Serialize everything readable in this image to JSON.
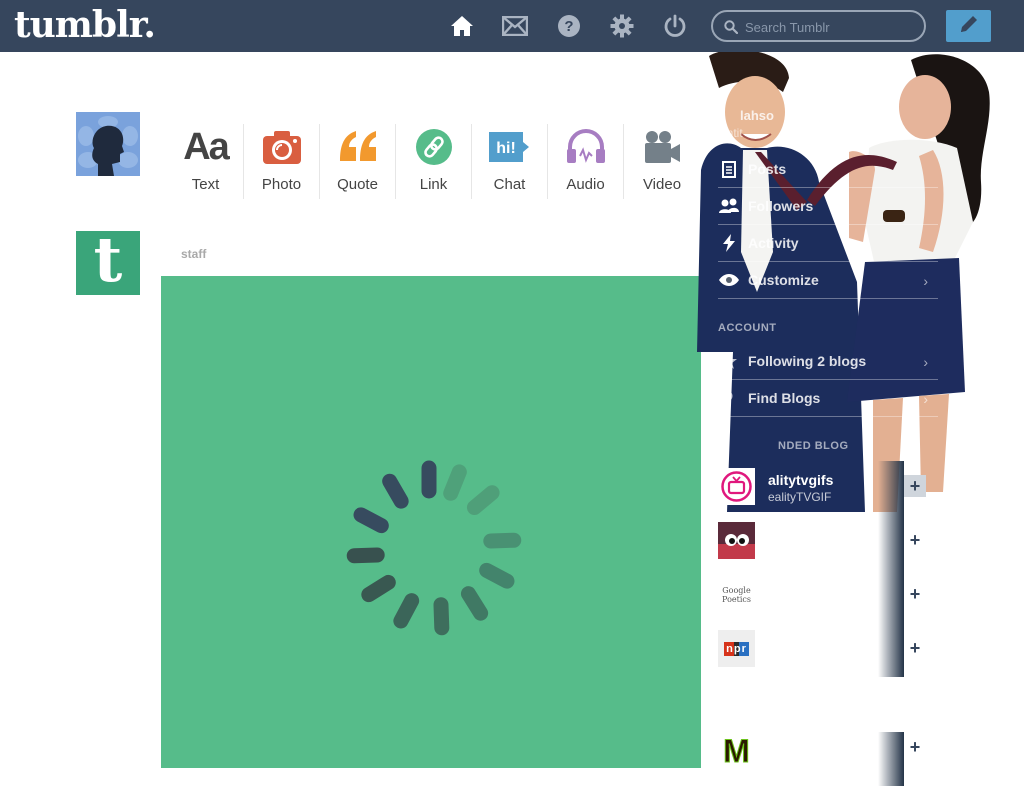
{
  "header": {
    "logo": "tumblr.",
    "search_placeholder": "Search Tumblr",
    "nav_icons": [
      "home-icon",
      "mail-icon",
      "help-icon",
      "gear-icon",
      "power-icon"
    ],
    "compose_icon": "pencil-icon"
  },
  "post_types": [
    {
      "label": "Text",
      "icon": "text-icon",
      "color": "#444444"
    },
    {
      "label": "Photo",
      "icon": "camera-icon",
      "color": "#d95e40"
    },
    {
      "label": "Quote",
      "icon": "quote-icon",
      "color": "#f2992e"
    },
    {
      "label": "Link",
      "icon": "link-icon",
      "color": "#56bc8a"
    },
    {
      "label": "Chat",
      "icon": "chat-icon",
      "color": "#529ecc"
    },
    {
      "label": "Audio",
      "icon": "headphones-icon",
      "color": "#a77dc2"
    },
    {
      "label": "Video",
      "icon": "video-camera-icon",
      "color": "#748089"
    }
  ],
  "post": {
    "author": "staff",
    "background": "#56bc8a"
  },
  "sidebar": {
    "blog_title": "lahso",
    "blog_subtitle": "Untit",
    "items": [
      {
        "label": "Posts",
        "icon": "document-icon"
      },
      {
        "label": "Followers",
        "icon": "people-icon"
      },
      {
        "label": "Activity",
        "icon": "lightning-icon"
      },
      {
        "label": "Customize",
        "icon": "eye-icon"
      }
    ],
    "account_heading": "ACCOUNT",
    "account_items": [
      {
        "label": "Following 2 blogs",
        "icon": "star-icon"
      },
      {
        "label": "Find Blogs",
        "icon": "search-icon"
      }
    ],
    "recommended_heading": "NDED BLOG",
    "recommended": [
      {
        "name": "alitytvgifs",
        "desc": "ealityTVGIF",
        "avatar": "tv-avatar"
      },
      {
        "name": "",
        "desc": "",
        "avatar": "googly-eyes-avatar"
      },
      {
        "name": "",
        "desc": "",
        "avatar": "google-poetics-avatar"
      },
      {
        "name": "",
        "desc": "",
        "avatar": "npr-avatar"
      },
      {
        "name": "",
        "desc": "",
        "avatar": "motherboard-avatar"
      }
    ],
    "google_text": "Google Poetics",
    "npr_text": "npr",
    "motherboard_text": "M"
  }
}
